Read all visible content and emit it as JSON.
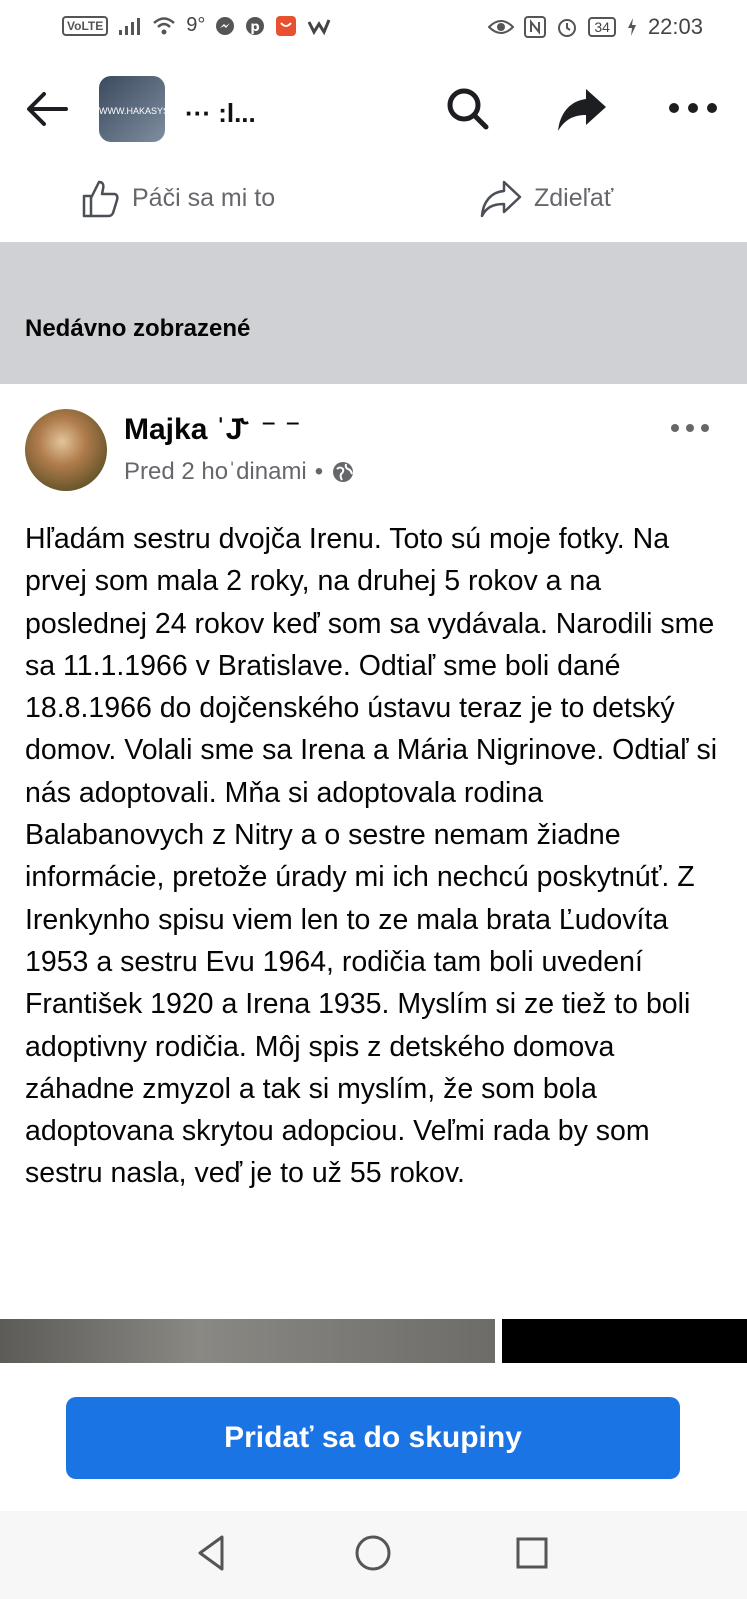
{
  "status_bar": {
    "volte": "VoLTE",
    "temperature": "9°",
    "battery": "34",
    "time": "22:03",
    "icons": [
      "signal-icon",
      "wifi-icon",
      "messenger-icon",
      "pinterest-icon",
      "aliexpress-icon",
      "app-w-icon",
      "eye-icon",
      "nfc-icon",
      "alarm-icon",
      "battery-icon",
      "charging-icon"
    ]
  },
  "top_nav": {
    "title": "​",
    "title_visible": "··· :l...",
    "thumb_text": "WWW.HAKASYS",
    "icons": [
      "back-arrow-icon",
      "search-icon",
      "share-icon",
      "more-icon"
    ]
  },
  "actions": {
    "like_label": "Páči sa mi to",
    "share_label": "Zdieľať"
  },
  "recent": {
    "label": "Nedávno zobrazené"
  },
  "post": {
    "author": "Majka ˈJ˞ ⁻ ⁻",
    "time": "Pred 2 hoˈdinami",
    "privacy_icon": "globe-icon",
    "text": "Hľadám sestru dvojča Irenu. Toto sú moje fotky. Na prvej som mala 2 roky, na druhej 5 rokov a na poslednej 24 rokov keď som sa vydávala. Narodili sme sa 11.1.1966 v Bratislave. Odtiaľ sme boli dané 18.8.1966 do dojčenského ústavu teraz je to detský domov. Volali sme sa Irena a Mária Nigrinove. Odtiaľ si nás adoptovali. Mňa si adoptovala rodina Balabanovych z Nitry a o sestre nemam žiadne informácie, pretože úrady mi ich nechcú poskytnúť. Z Irenkynho spisu viem len to ze mala brata Ľudovíta 1953 a sestru Evu 1964, rodičia tam boli uvedení František 1920 a Irena 1935. Myslím si ze tiež to boli adoptivny rodičia. Môj spis z detského domova záhadne zmyzol a tak si myslím, že som bola adoptovana skrytou adopciou. Veľmi rada by som sestru nasla, veď je to už 55 rokov."
  },
  "join_button": {
    "label": "Pridať sa do skupiny",
    "color": "#1b74e4"
  },
  "system_nav": {
    "icons": [
      "back-triangle-icon",
      "home-circle-icon",
      "recents-square-icon"
    ]
  }
}
